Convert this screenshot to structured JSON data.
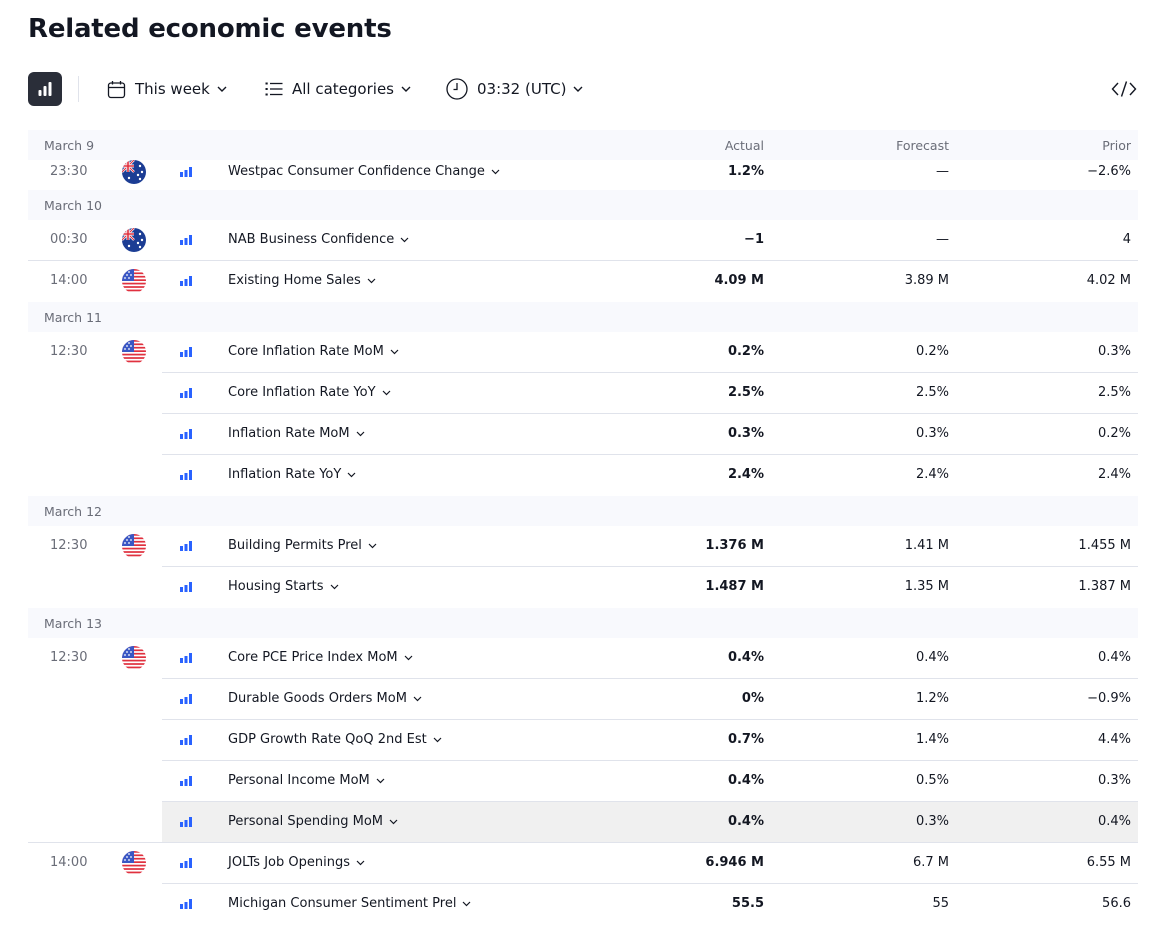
{
  "page": {
    "title": "Related economic events"
  },
  "toolbar": {
    "period": "This week",
    "categories": "All categories",
    "timezone": "03:32 (UTC)"
  },
  "columns": {
    "actual": "Actual",
    "forecast": "Forecast",
    "prior": "Prior"
  },
  "groups": [
    {
      "date": "March 9",
      "rows": [
        {
          "time": "23:30",
          "flag": "au",
          "event": "Westpac Consumer Confidence Change",
          "actual": "1.2%",
          "forecast": "—",
          "prior": "−2.6%"
        }
      ]
    },
    {
      "date": "March 10",
      "rows": [
        {
          "time": "00:30",
          "flag": "au",
          "event": "NAB Business Confidence",
          "actual": "−1",
          "forecast": "—",
          "prior": "4"
        },
        {
          "time": "14:00",
          "flag": "us",
          "event": "Existing Home Sales",
          "actual": "4.09 M",
          "forecast": "3.89 M",
          "prior": "4.02 M"
        }
      ]
    },
    {
      "date": "March 11",
      "rows": [
        {
          "time": "12:30",
          "flag": "us",
          "event": "Core Inflation Rate MoM",
          "actual": "0.2%",
          "forecast": "0.2%",
          "prior": "0.3%"
        },
        {
          "time": "",
          "flag": "",
          "event": "Core Inflation Rate YoY",
          "actual": "2.5%",
          "forecast": "2.5%",
          "prior": "2.5%"
        },
        {
          "time": "",
          "flag": "",
          "event": "Inflation Rate MoM",
          "actual": "0.3%",
          "forecast": "0.3%",
          "prior": "0.2%"
        },
        {
          "time": "",
          "flag": "",
          "event": "Inflation Rate YoY",
          "actual": "2.4%",
          "forecast": "2.4%",
          "prior": "2.4%"
        }
      ]
    },
    {
      "date": "March 12",
      "rows": [
        {
          "time": "12:30",
          "flag": "us",
          "event": "Building Permits Prel",
          "actual": "1.376 M",
          "forecast": "1.41 M",
          "prior": "1.455 M"
        },
        {
          "time": "",
          "flag": "",
          "event": "Housing Starts",
          "actual": "1.487 M",
          "forecast": "1.35 M",
          "prior": "1.387 M"
        }
      ]
    },
    {
      "date": "March 13",
      "rows": [
        {
          "time": "12:30",
          "flag": "us",
          "event": "Core PCE Price Index MoM",
          "actual": "0.4%",
          "forecast": "0.4%",
          "prior": "0.4%"
        },
        {
          "time": "",
          "flag": "",
          "event": "Durable Goods Orders MoM",
          "actual": "0%",
          "forecast": "1.2%",
          "prior": "−0.9%"
        },
        {
          "time": "",
          "flag": "",
          "event": "GDP Growth Rate QoQ 2nd Est",
          "actual": "0.7%",
          "forecast": "1.4%",
          "prior": "4.4%"
        },
        {
          "time": "",
          "flag": "",
          "event": "Personal Income MoM",
          "actual": "0.4%",
          "forecast": "0.5%",
          "prior": "0.3%"
        },
        {
          "time": "",
          "flag": "",
          "event": "Personal Spending MoM",
          "actual": "0.4%",
          "forecast": "0.3%",
          "prior": "0.4%",
          "highlight": true
        },
        {
          "time": "14:00",
          "flag": "us",
          "event": "JOLTs Job Openings",
          "actual": "6.946 M",
          "forecast": "6.7 M",
          "prior": "6.55 M"
        },
        {
          "time": "",
          "flag": "",
          "event": "Michigan Consumer Sentiment Prel",
          "actual": "55.5",
          "forecast": "55",
          "prior": "56.6"
        }
      ]
    }
  ],
  "colors": {
    "importance": "#2962ff",
    "text": "#131722",
    "muted": "#6a6d78",
    "header_bg": "#f8f9fd",
    "divider": "#e0e3eb"
  }
}
